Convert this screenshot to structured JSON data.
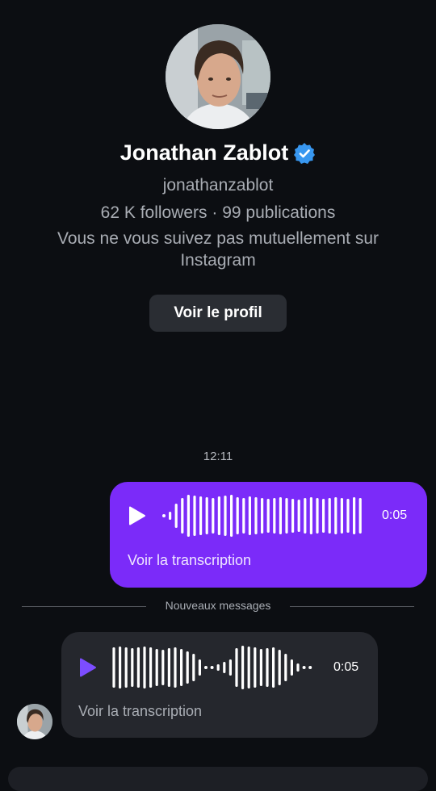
{
  "profile": {
    "name": "Jonathan Zablot",
    "username": "jonathanzablot",
    "stats": "62 K followers · 99 publications",
    "mutual_line1": "Vous ne vous suivez pas mutuellement sur",
    "mutual_line2": "Instagram",
    "view_profile_label": "Voir le profil"
  },
  "chat": {
    "timestamp": "12:11",
    "divider_label": "Nouveaux messages",
    "messages": [
      {
        "direction": "outgoing",
        "duration": "0:05",
        "transcript_label": "Voir la transcription"
      },
      {
        "direction": "incoming",
        "duration": "0:05",
        "transcript_label": "Voir la transcription"
      }
    ]
  },
  "colors": {
    "background": "#0c0e12",
    "outgoing_bubble": "#7b2bf9",
    "incoming_bubble": "#25272d",
    "verified_badge": "#3897f0",
    "incoming_play": "#7c4dff"
  },
  "icons": [
    "verified-badge-icon",
    "play-icon",
    "waveform-icon",
    "avatar"
  ]
}
